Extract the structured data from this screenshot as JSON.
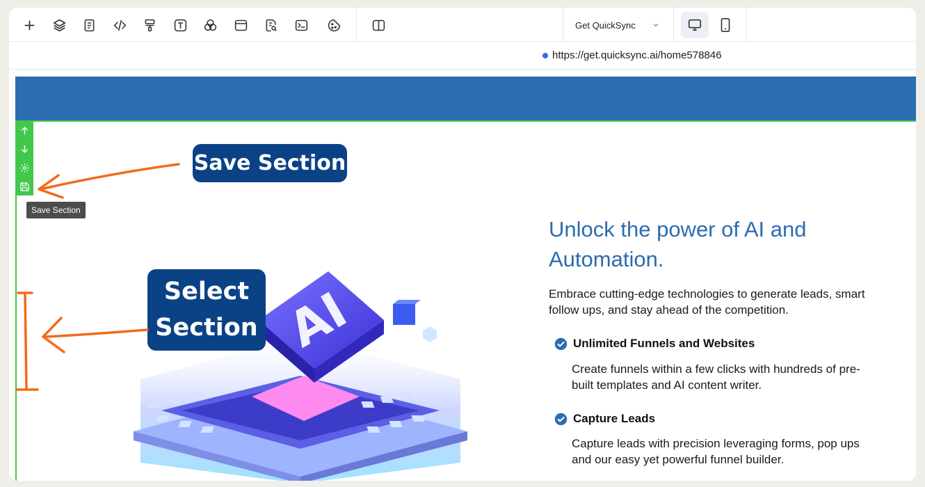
{
  "toolbar": {
    "icons": [
      "plus-icon",
      "layers-icon",
      "page-icon",
      "code-icon",
      "paint-roller-icon",
      "text-icon",
      "color-blend-icon",
      "browser-window-icon",
      "page-search-icon",
      "terminal-icon",
      "cookie-icon",
      "split-view-icon"
    ],
    "site_selector": "Get QuickSync",
    "devices": [
      "desktop-icon",
      "mobile-icon"
    ],
    "active_device": "desktop"
  },
  "urlbar": {
    "url": "https://get.quicksync.ai/home578846",
    "status_color": "#2f6fe0"
  },
  "section_tools": {
    "items": [
      "arrow-up-icon",
      "arrow-down-icon",
      "gear-icon",
      "save-icon"
    ],
    "tooltip": "Save Section",
    "color": "#41c84a"
  },
  "callouts": {
    "save": "Save Section",
    "select_line1": "Select",
    "select_line2": "Section",
    "color": "#0b4286",
    "arrow_color": "#f26a1b"
  },
  "hero": {
    "band_color": "#2c6cb0",
    "headline": "Unlock the power of AI and Automation.",
    "intro": "Embrace cutting-edge technologies to generate leads, smart follow ups, and stay ahead of the competition.",
    "features": [
      {
        "title": "Unlimited Funnels and Websites",
        "desc": "Create funnels within a few clicks with hundreds of pre-built templates and AI content writer."
      },
      {
        "title": "Capture Leads",
        "desc": "Capture leads with precision leveraging forms, pop ups and our easy yet powerful funnel builder."
      }
    ],
    "illustration_text": "AI"
  }
}
